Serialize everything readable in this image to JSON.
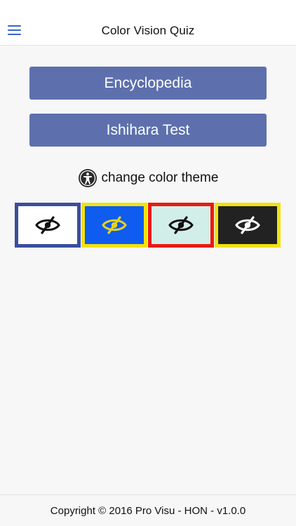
{
  "header": {
    "title": "Color Vision Quiz",
    "menu_icon": "hamburger-menu-icon"
  },
  "buttons": {
    "encyclopedia": "Encyclopedia",
    "ishihara": "Ishihara Test"
  },
  "theme": {
    "label": "change color theme",
    "label_icon": "accessibility-icon",
    "options": [
      {
        "name": "light",
        "background": "#ffffff",
        "border": "#3a4f99",
        "icon_color": "#111111",
        "icon": "eye-slash-icon"
      },
      {
        "name": "blue-yellow",
        "background": "#0f5cf0",
        "border": "#f2e20c",
        "icon_color": "#e6d21a",
        "icon": "eye-slash-icon"
      },
      {
        "name": "mint-red",
        "background": "#d2eee8",
        "border": "#e81a16",
        "icon_color": "#111111",
        "icon": "eye-slash-icon"
      },
      {
        "name": "dark-yellow",
        "background": "#222222",
        "border": "#f2e20c",
        "icon_color": "#ffffff",
        "icon": "eye-slash-icon"
      }
    ]
  },
  "colors": {
    "accent": "#3a64c9",
    "button_bg": "#5d70ad"
  },
  "footer": {
    "copyright": "Copyright © 2016 Pro Visu - HON - v1.0.0"
  }
}
